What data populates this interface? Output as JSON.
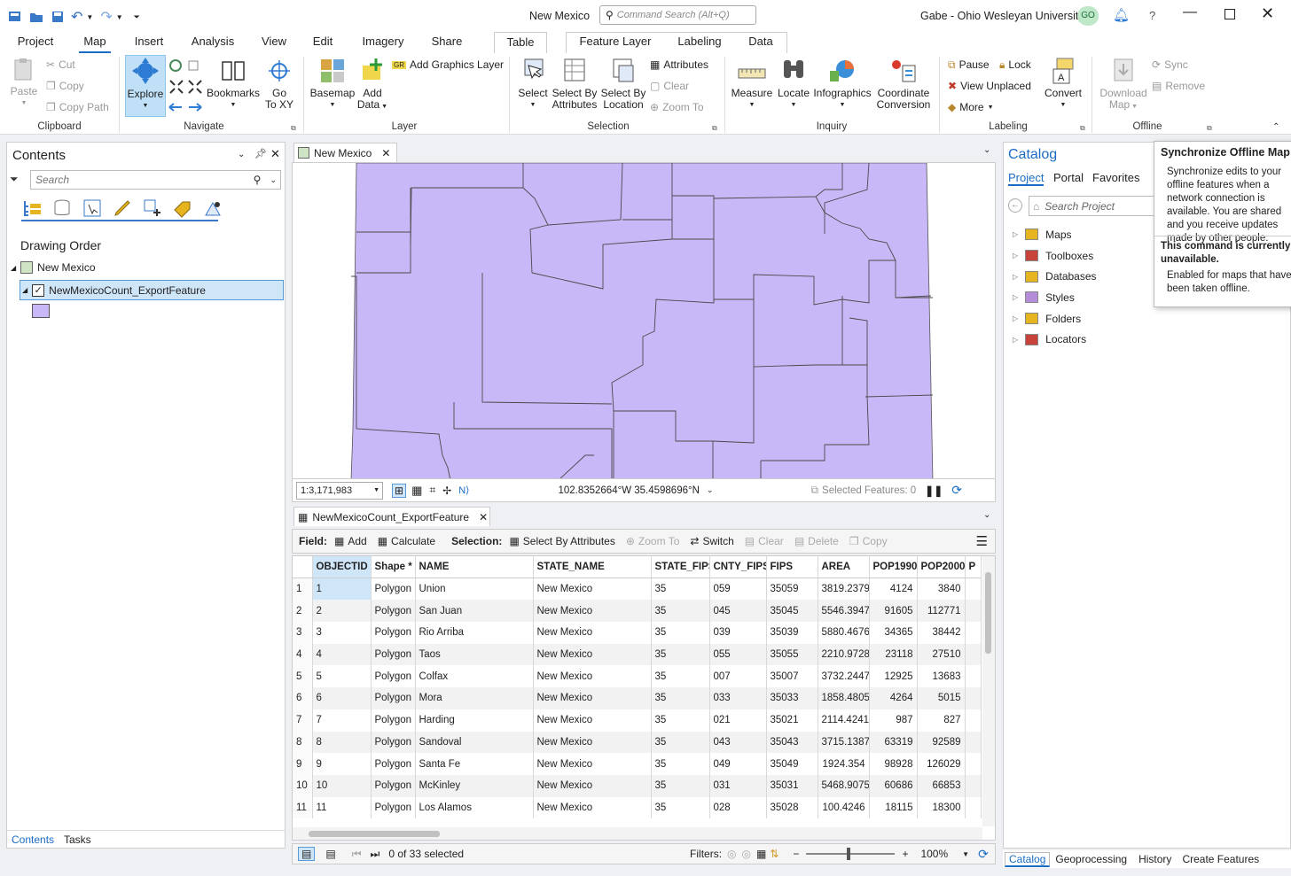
{
  "title_bar": {
    "doc_title": "New Mexico",
    "command_search_placeholder": "Command Search (Alt+Q)",
    "user": "Gabe - Ohio Wesleyan University",
    "avatar_initials": "GO",
    "help": "?"
  },
  "ribbon_tabs": {
    "project": "Project",
    "map": "Map",
    "insert": "Insert",
    "analysis": "Analysis",
    "view": "View",
    "edit": "Edit",
    "imagery": "Imagery",
    "share": "Share",
    "table": "Table",
    "feature_layer": "Feature Layer",
    "labeling": "Labeling",
    "data": "Data"
  },
  "ribbon": {
    "clipboard": {
      "paste": "Paste",
      "cut": "Cut",
      "copy": "Copy",
      "copy_path": "Copy Path",
      "group": "Clipboard"
    },
    "navigate": {
      "explore": "Explore",
      "bookmarks": "Bookmarks",
      "goto_xy_1": "Go",
      "goto_xy_2": "To XY",
      "group": "Navigate"
    },
    "layer": {
      "basemap": "Basemap",
      "add_data_1": "Add",
      "add_data_2": "Data",
      "add_graphics": "Add Graphics Layer",
      "group": "Layer"
    },
    "selection": {
      "select": "Select",
      "by_attr_1": "Select By",
      "by_attr_2": "Attributes",
      "by_loc_1": "Select By",
      "by_loc_2": "Location",
      "attributes": "Attributes",
      "clear": "Clear",
      "zoom_to": "Zoom To",
      "group": "Selection"
    },
    "inquiry": {
      "measure": "Measure",
      "locate": "Locate",
      "infographics": "Infographics",
      "coord_1": "Coordinate",
      "coord_2": "Conversion",
      "group": "Inquiry"
    },
    "labeling": {
      "pause": "Pause",
      "lock": "Lock",
      "view_unplaced": "View Unplaced",
      "more": "More",
      "convert": "Convert",
      "group": "Labeling"
    },
    "offline": {
      "download_1": "Download",
      "download_2": "Map",
      "sync": "Sync",
      "remove": "Remove",
      "group": "Offline"
    }
  },
  "contents": {
    "title": "Contents",
    "search_placeholder": "Search",
    "drawing_order": "Drawing Order",
    "map_name": "New Mexico",
    "layer_name": "NewMexicoCount_ExportFeature",
    "tabs": {
      "contents": "Contents",
      "tasks": "Tasks"
    }
  },
  "map_view": {
    "tab": "New Mexico",
    "scale": "1:3,171,983",
    "coordinates": "102.8352664°W 35.4598696°N",
    "selected_features": "Selected Features: 0",
    "fill_color": "#c9b8f7"
  },
  "table_view": {
    "tab": "NewMexicoCount_ExportFeature",
    "field_label": "Field:",
    "add": "Add",
    "calculate": "Calculate",
    "selection_label": "Selection:",
    "select_by_attributes": "Select By Attributes",
    "zoom_to": "Zoom To",
    "switch": "Switch",
    "clear": "Clear",
    "delete": "Delete",
    "copy": "Copy",
    "columns": [
      "OBJECTID *",
      "Shape *",
      "NAME",
      "STATE_NAME",
      "STATE_FIPS",
      "CNTY_FIPS",
      "FIPS",
      "AREA",
      "POP1990",
      "POP2000",
      "P"
    ],
    "rows": [
      [
        "1",
        "1",
        "Polygon",
        "Union",
        "New Mexico",
        "35",
        "059",
        "35059",
        "3819.2379",
        "4124",
        "3840"
      ],
      [
        "2",
        "2",
        "Polygon",
        "San Juan",
        "New Mexico",
        "35",
        "045",
        "35045",
        "5546.3947",
        "91605",
        "112771"
      ],
      [
        "3",
        "3",
        "Polygon",
        "Rio Arriba",
        "New Mexico",
        "35",
        "039",
        "35039",
        "5880.4676",
        "34365",
        "38442"
      ],
      [
        "4",
        "4",
        "Polygon",
        "Taos",
        "New Mexico",
        "35",
        "055",
        "35055",
        "2210.9728",
        "23118",
        "27510"
      ],
      [
        "5",
        "5",
        "Polygon",
        "Colfax",
        "New Mexico",
        "35",
        "007",
        "35007",
        "3732.2447",
        "12925",
        "13683"
      ],
      [
        "6",
        "6",
        "Polygon",
        "Mora",
        "New Mexico",
        "35",
        "033",
        "35033",
        "1858.4805",
        "4264",
        "5015"
      ],
      [
        "7",
        "7",
        "Polygon",
        "Harding",
        "New Mexico",
        "35",
        "021",
        "35021",
        "2114.4241",
        "987",
        "827"
      ],
      [
        "8",
        "8",
        "Polygon",
        "Sandoval",
        "New Mexico",
        "35",
        "043",
        "35043",
        "3715.1387",
        "63319",
        "92589"
      ],
      [
        "9",
        "9",
        "Polygon",
        "Santa Fe",
        "New Mexico",
        "35",
        "049",
        "35049",
        "1924.354",
        "98928",
        "126029"
      ],
      [
        "10",
        "10",
        "Polygon",
        "McKinley",
        "New Mexico",
        "35",
        "031",
        "35031",
        "5468.9075",
        "60686",
        "66853"
      ],
      [
        "11",
        "11",
        "Polygon",
        "Los Alamos",
        "New Mexico",
        "35",
        "028",
        "35028",
        "100.4246",
        "18115",
        "18300"
      ]
    ],
    "status": "0 of 33 selected",
    "filters": "Filters:",
    "zoom": "100%"
  },
  "catalog": {
    "title": "Catalog",
    "tabs": {
      "project": "Project",
      "portal": "Portal",
      "favorites": "Favorites"
    },
    "search_placeholder": "Search Project",
    "items": [
      "Maps",
      "Toolboxes",
      "Databases",
      "Styles",
      "Folders",
      "Locators"
    ],
    "bottom_tabs": {
      "catalog": "Catalog",
      "geoprocessing": "Geoprocessing",
      "history": "History",
      "create_features": "Create Features"
    }
  },
  "tooltip": {
    "title": "Synchronize Offline Map",
    "body": "Synchronize edits to your offline features when a network connection is available. You are shared and you receive updates made by other people.",
    "unavailable": "This command is currently unavailable.",
    "enabled_note": "Enabled for maps that have been taken offline."
  }
}
